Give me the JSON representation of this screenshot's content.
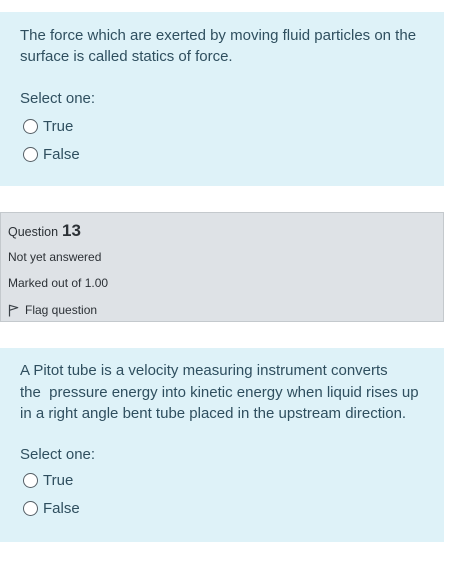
{
  "question12": {
    "text": "The force which are exerted by moving fluid particles on the surface is called statics of force.",
    "prompt": "Select one:",
    "options": [
      "True",
      "False"
    ]
  },
  "question13_info": {
    "label": "Question",
    "number": "13",
    "state": "Not yet answered",
    "grade": "Marked out of 1.00",
    "flag_label": "Flag question",
    "flag_icon": "flag-outline-icon"
  },
  "question13": {
    "text_lines": [
      "A Pitot tube is a velocity measuring instrument converts",
      "the  pressure energy into kinetic energy when liquid rises up",
      "in a right angle bent tube placed in the upstream direction."
    ],
    "prompt": "Select one:",
    "options": [
      "True",
      "False"
    ]
  },
  "colors": {
    "card_background": "#def2f8",
    "info_background": "#dee2e6",
    "text": "#2f4f5f"
  }
}
